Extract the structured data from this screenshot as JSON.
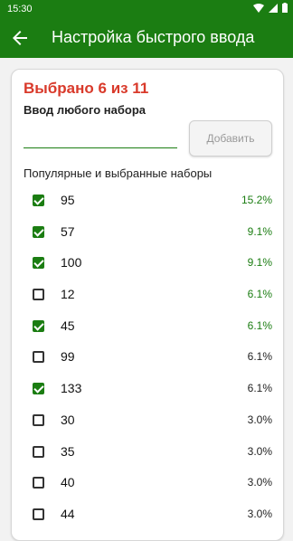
{
  "status_bar": {
    "time": "15:30",
    "icons": [
      "wifi-icon",
      "signal-icon",
      "battery-icon"
    ]
  },
  "app_bar": {
    "title": "Настройка быстрого ввода",
    "back_icon": "arrow-left-icon"
  },
  "card": {
    "selected_text": "Выбрано 6 из 11",
    "input_label": "Ввод любого набора",
    "input_value": "",
    "add_button": "Добавить",
    "section_title": "Популярные и выбранные наборы",
    "items": [
      {
        "value": "95",
        "percent": "15.2%",
        "checked": true,
        "percent_color": "green"
      },
      {
        "value": "57",
        "percent": "9.1%",
        "checked": true,
        "percent_color": "green"
      },
      {
        "value": "100",
        "percent": "9.1%",
        "checked": true,
        "percent_color": "green"
      },
      {
        "value": "12",
        "percent": "6.1%",
        "checked": false,
        "percent_color": "green"
      },
      {
        "value": "45",
        "percent": "6.1%",
        "checked": true,
        "percent_color": "green"
      },
      {
        "value": "99",
        "percent": "6.1%",
        "checked": false,
        "percent_color": "black"
      },
      {
        "value": "133",
        "percent": "6.1%",
        "checked": true,
        "percent_color": "black"
      },
      {
        "value": "30",
        "percent": "3.0%",
        "checked": false,
        "percent_color": "black"
      },
      {
        "value": "35",
        "percent": "3.0%",
        "checked": false,
        "percent_color": "black"
      },
      {
        "value": "40",
        "percent": "3.0%",
        "checked": false,
        "percent_color": "black"
      },
      {
        "value": "44",
        "percent": "3.0%",
        "checked": false,
        "percent_color": "black"
      }
    ]
  },
  "colors": {
    "primary": "#1b7d12",
    "accent_red": "#d93a2b"
  }
}
